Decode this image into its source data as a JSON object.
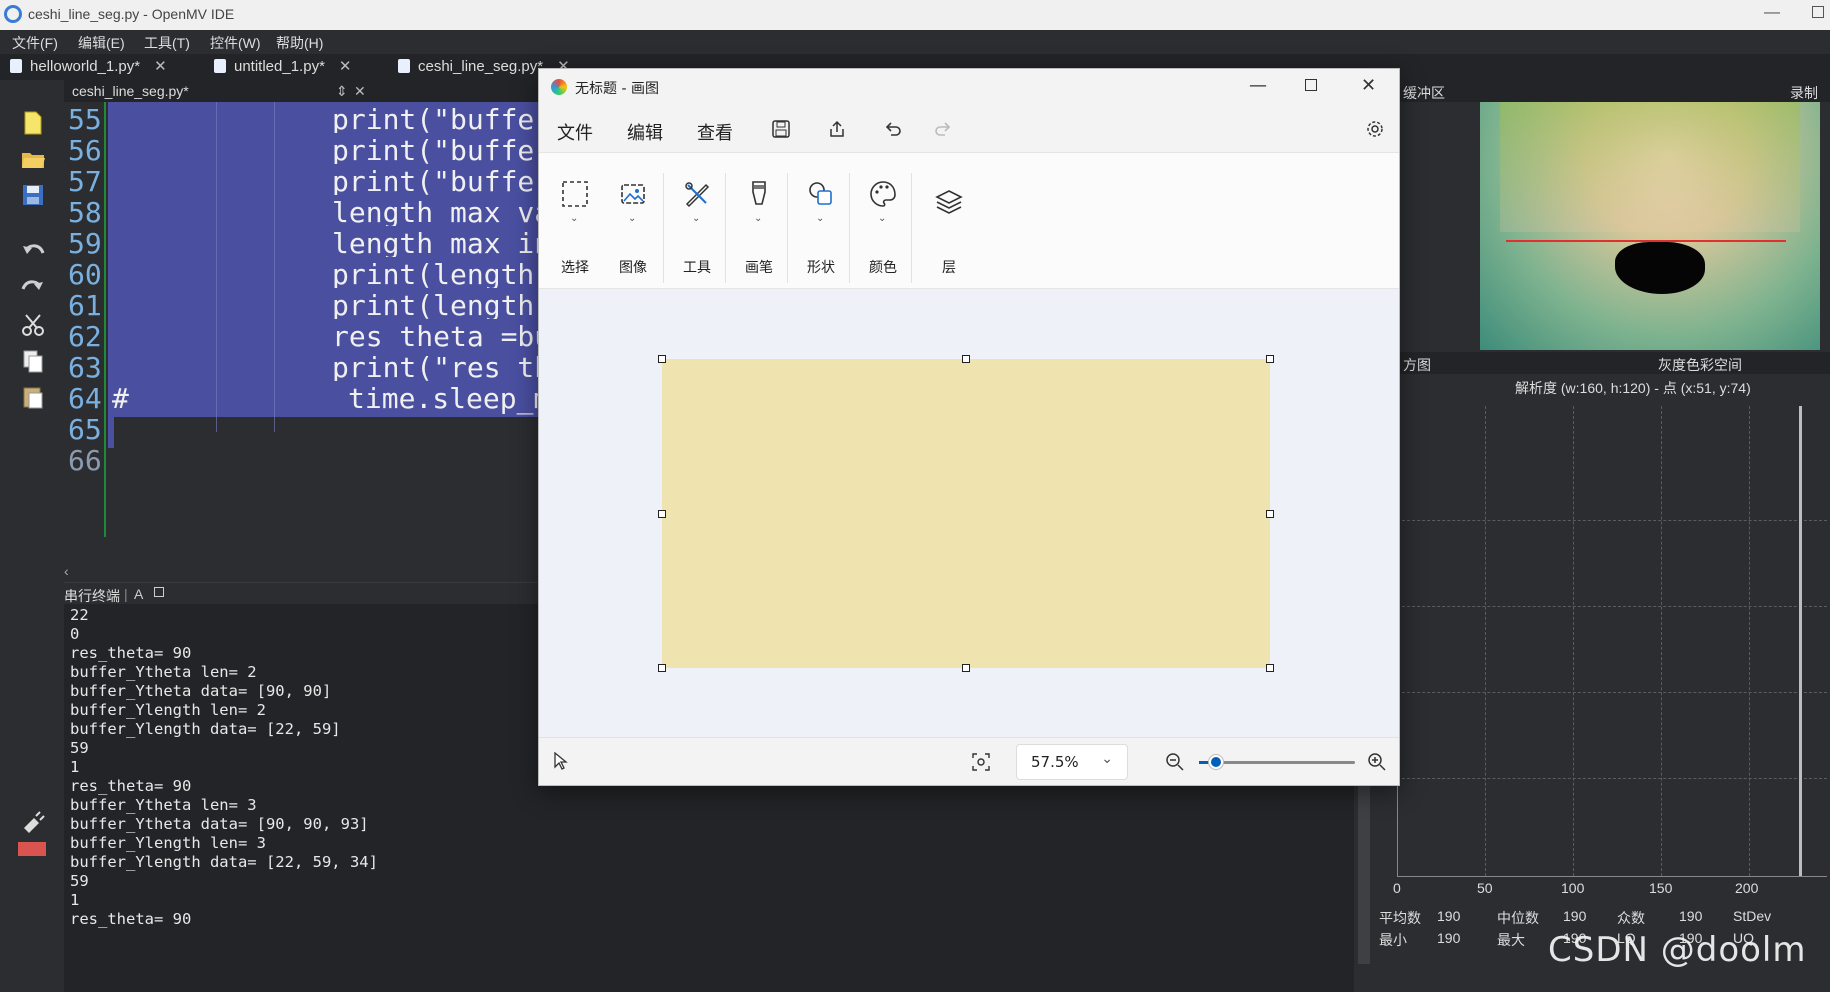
{
  "window": {
    "title": "ceshi_line_seg.py - OpenMV IDE"
  },
  "menu": [
    "文件(F)",
    "编辑(E)",
    "工具(T)",
    "控件(W)",
    "帮助(H)"
  ],
  "tabs": [
    {
      "label": "helloworld_1.py*"
    },
    {
      "label": "untitled_1.py*"
    },
    {
      "label": "ceshi_line_seg.py*"
    }
  ],
  "editor": {
    "file_label": "ceshi_line_seg.py*",
    "lines": [
      {
        "num": "55",
        "text": "print(\"buffer_"
      },
      {
        "num": "56",
        "text": "print(\"buffer_"
      },
      {
        "num": "57",
        "text": "print(\"buffer_"
      },
      {
        "num": "58",
        "text": "length_max_va"
      },
      {
        "num": "59",
        "text": "length_max_in"
      },
      {
        "num": "60",
        "text": "print(length_"
      },
      {
        "num": "61",
        "text": "print(length_"
      },
      {
        "num": "62",
        "text": "res_theta =bu"
      },
      {
        "num": "63",
        "text": "print(\"res_th"
      },
      {
        "num": "64",
        "text": "time.sleep_m",
        "prefix": "#"
      },
      {
        "num": "65",
        "text": ""
      },
      {
        "num": "66",
        "text": ""
      }
    ]
  },
  "terminal": {
    "label": "串行终端",
    "lines": [
      "22",
      "0",
      "res_theta= 90",
      "buffer_Ytheta len= 2",
      "buffer_Ytheta data= [90, 90]",
      "buffer_Ylength len= 2",
      "buffer_Ylength data= [22, 59]",
      "59",
      "1",
      "res_theta= 90",
      "buffer_Ytheta len= 3",
      "buffer_Ytheta data= [90, 90, 93]",
      "buffer_Ylength len= 3",
      "buffer_Ylength data= [22, 59, 34]",
      "59",
      "1",
      "res_theta= 90"
    ]
  },
  "right_panel": {
    "framebuffer_label": "缓冲区",
    "record_label": "录制",
    "histogram_label": "方图",
    "colorspace_label": "灰度色彩空间",
    "resolution_text": "解析度 (w:160, h:120) - 点 (x:51, y:74)",
    "x_ticks": [
      "0",
      "50",
      "100",
      "150",
      "200"
    ],
    "stats": {
      "mean_label": "平均数",
      "mean": "190",
      "median_label": "中位数",
      "median": "190",
      "mode_label": "众数",
      "mode": "190",
      "stdev_label": "StDev",
      "min_label": "最小",
      "min": "190",
      "max_label": "最大",
      "max": "190",
      "lq_label": "LQ",
      "lq": "190",
      "uq_label": "UQ"
    }
  },
  "paint": {
    "title": "无标题 - 画图",
    "menu": [
      "文件",
      "编辑",
      "查看"
    ],
    "tools": [
      "选择",
      "图像",
      "工具",
      "画笔",
      "形状",
      "颜色",
      "层"
    ],
    "zoom": "57.5%",
    "canvas_color": "#efe3b0"
  },
  "watermark": "CSDN @doolm"
}
